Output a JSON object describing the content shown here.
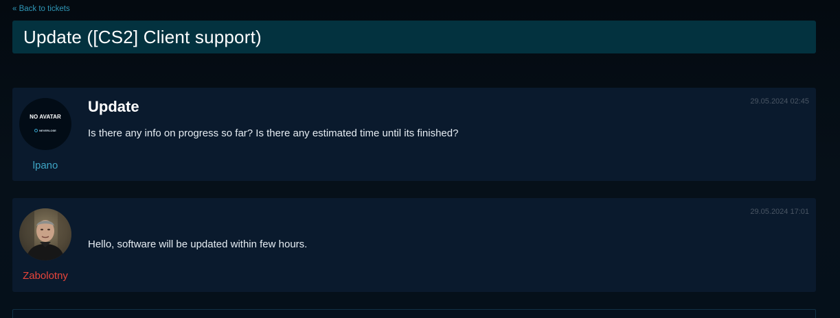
{
  "nav": {
    "back_link": "« Back to tickets"
  },
  "ticket": {
    "title": "Update ([CS2] Client support)"
  },
  "posts": [
    {
      "author": "lpano",
      "avatar": {
        "type": "no-avatar",
        "text": "NO AVATAR",
        "brand": "NEVERLOSE"
      },
      "author_color": "#3ea6c6",
      "date": "29.05.2024 02:45",
      "title": "Update",
      "body": "Is there any info on progress so far? Is there any estimated time until its finished?"
    },
    {
      "author": "Zabolotny",
      "avatar": {
        "type": "photo"
      },
      "author_color": "#e8443a",
      "date": "29.05.2024 17:01",
      "title": "",
      "body": "Hello, software will be updated within few hours."
    }
  ],
  "colors": {
    "background": "#05090e",
    "title_bar": "#03323f",
    "post_background": "#0a1a2d",
    "link": "#2f97b7"
  }
}
